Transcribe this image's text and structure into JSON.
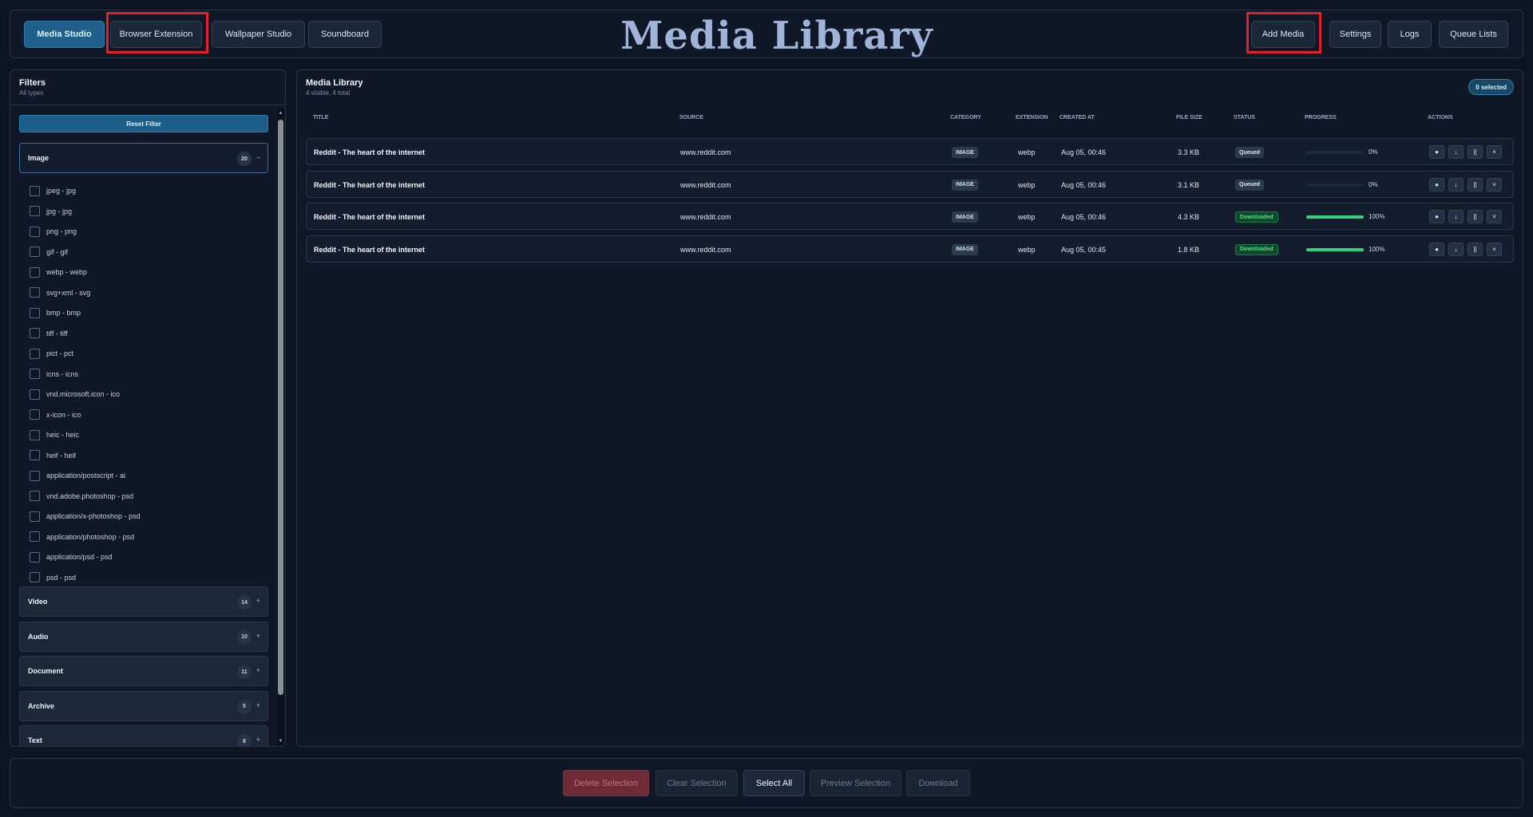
{
  "header": {
    "title": "Media Library",
    "nav_left": [
      "Media Studio",
      "Browser Extension",
      "Wallpaper Studio",
      "Soundboard"
    ],
    "nav_right": [
      "Add Media",
      "Settings",
      "Logs",
      "Queue Lists"
    ]
  },
  "sidebar": {
    "title": "Filters",
    "subtitle": "All types",
    "reset_label": "Reset Filter",
    "open_group": {
      "label": "Image",
      "count": "20",
      "toggle": "–"
    },
    "types": [
      "jpeg - jpg",
      "jpg - jpg",
      "png - png",
      "gif - gif",
      "webp - webp",
      "svg+xml - svg",
      "bmp - bmp",
      "tiff - tiff",
      "pict - pct",
      "icns - icns",
      "vnd.microsoft.icon - ico",
      "x-icon - ico",
      "heic - heic",
      "heif - heif",
      "application/postscript - ai",
      "vnd.adobe.photoshop - psd",
      "application/x-photoshop - psd",
      "application/photoshop - psd",
      "application/psd - psd",
      "psd - psd"
    ],
    "groups": [
      {
        "label": "Video",
        "count": "14",
        "toggle": "+"
      },
      {
        "label": "Audio",
        "count": "10",
        "toggle": "+"
      },
      {
        "label": "Document",
        "count": "11",
        "toggle": "+"
      },
      {
        "label": "Archive",
        "count": "5",
        "toggle": "+"
      },
      {
        "label": "Text",
        "count": "8",
        "toggle": "+"
      }
    ]
  },
  "main": {
    "title": "Media Library",
    "subtitle": "4 visible, 4 total",
    "selected_badge": "0 selected",
    "columns": [
      "TITLE",
      "SOURCE",
      "CATEGORY",
      "EXTENSION",
      "CREATED AT",
      "FILE SIZE",
      "STATUS",
      "PROGRESS",
      "ACTIONS"
    ],
    "rows": [
      {
        "title": "Reddit - The heart of the internet",
        "source": "www.reddit.com",
        "category": "IMAGE",
        "extension": "webp",
        "created": "Aug 05, 00:46",
        "size": "3.3 KB",
        "status": "Queued",
        "progress": 0,
        "progress_label": "0%"
      },
      {
        "title": "Reddit - The heart of the internet",
        "source": "www.reddit.com",
        "category": "IMAGE",
        "extension": "webp",
        "created": "Aug 05, 00:46",
        "size": "3.1 KB",
        "status": "Queued",
        "progress": 0,
        "progress_label": "0%"
      },
      {
        "title": "Reddit - The heart of the internet",
        "source": "www.reddit.com",
        "category": "IMAGE",
        "extension": "webp",
        "created": "Aug 05, 00:46",
        "size": "4.3 KB",
        "status": "Downloaded",
        "progress": 100,
        "progress_label": "100%"
      },
      {
        "title": "Reddit - The heart of the internet",
        "source": "www.reddit.com",
        "category": "IMAGE",
        "extension": "webp",
        "created": "Aug 05, 00:45",
        "size": "1.8 KB",
        "status": "Downloaded",
        "progress": 100,
        "progress_label": "100%"
      }
    ],
    "action_glyphs": [
      "●",
      "↓",
      "||",
      "×"
    ]
  },
  "footer": {
    "buttons": [
      "Delete Selection",
      "Clear Selection",
      "Select All",
      "Preview Selection",
      "Download"
    ]
  },
  "colors": {
    "accent": "#1f5f8a",
    "success": "#35d07f",
    "highlight": "#e0202a",
    "danger": "#6e2b35"
  }
}
